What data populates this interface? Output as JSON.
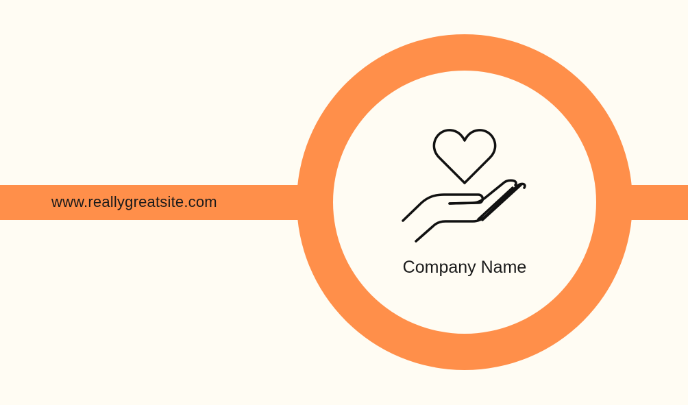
{
  "card": {
    "website": "www.reallygreatsite.com",
    "company_name": "Company Name",
    "logo_icon": "heart-in-hand-icon"
  },
  "colors": {
    "background": "#fffcf3",
    "accent": "#ff8f4a",
    "text": "#1a1a1a"
  }
}
